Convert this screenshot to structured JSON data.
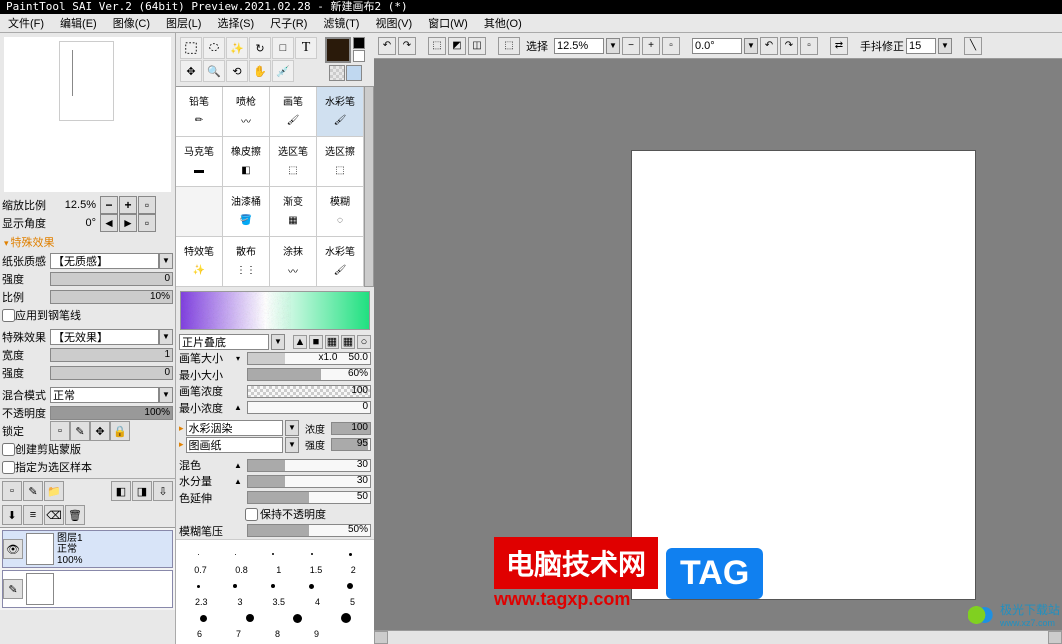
{
  "title": "PaintTool SAI Ver.2 (64bit) Preview.2021.02.28 - 新建画布2 (*)",
  "menu": [
    "文件(F)",
    "编辑(E)",
    "图像(C)",
    "图层(L)",
    "选择(S)",
    "尺子(R)",
    "滤镜(T)",
    "视图(V)",
    "窗口(W)",
    "其他(O)"
  ],
  "nav": {
    "zoom_label": "缩放比例",
    "zoom_val": "12.5%",
    "angle_label": "显示角度",
    "angle_val": "0°"
  },
  "fx": {
    "header": "特殊效果",
    "paper_label": "纸张质感",
    "paper_val": "【无质感】",
    "intensity_label": "强度",
    "intensity_val": "0",
    "ratio_label": "比例",
    "ratio_val": "10%",
    "pen_line": "应用到钢笔线",
    "effect_label": "特殊效果",
    "effect_val": "【无效果】",
    "width_label": "宽度",
    "width_val": "1",
    "intensity2_label": "强度",
    "intensity2_val": "0"
  },
  "layer": {
    "blend_label": "混合模式",
    "blend_val": "正常",
    "opacity_label": "不透明度",
    "opacity_val": "100%",
    "lock_label": "锁定",
    "clip_label": "创建剪贴蒙版",
    "sel_src_label": "指定为选区样本",
    "layer1_name": "图层1",
    "layer1_mode": "正常",
    "layer1_op": "100%"
  },
  "brush_names": [
    "铅笔",
    "喷枪",
    "画笔",
    "水彩笔",
    "马克笔",
    "橡皮擦",
    "选区笔",
    "选区擦",
    "",
    "油漆桶",
    "渐变",
    "模糊",
    "特效笔",
    "散布",
    "涂抹",
    "水彩笔"
  ],
  "blend2": "正片叠底",
  "params": {
    "size_label": "画笔大小",
    "size_mult": "x1.0",
    "size_val": "50.0",
    "minsize_label": "最小大小",
    "minsize_val": "60%",
    "density_label": "画笔浓度",
    "density_val": "100",
    "mindensity_label": "最小浓度",
    "mindensity_val": "0",
    "wc_label": "水彩洇染",
    "wc_amt_label": "浓度",
    "wc_amt_val": "100",
    "paper_label": "图画纸",
    "paper_amt_label": "强度",
    "paper_amt_val": "95",
    "mix_label": "混色",
    "mix_val": "30",
    "water_label": "水分量",
    "water_val": "30",
    "extend_label": "色延伸",
    "extend_val": "50",
    "keep_opacity": "保持不透明度",
    "blur_label": "模糊笔压",
    "blur_val": "50%"
  },
  "topbar": {
    "select_label": "选择",
    "zoom": "12.5%",
    "angle": "0.0°",
    "stabilizer_label": "手抖修正",
    "stabilizer_val": "15"
  },
  "dots_labels1": [
    "0.7",
    "0.8",
    "1",
    "1.5",
    "2"
  ],
  "dots_labels2": [
    "2.3",
    "3",
    "3.5",
    "4",
    "5"
  ],
  "dots_labels3": [
    "6",
    "7",
    "8",
    "9"
  ],
  "watermark": {
    "txt1": "电脑技术网",
    "url": "www.tagxp.com",
    "tag": "TAG",
    "site": "极光下载站",
    "siteurl": "www.xz7.com"
  }
}
